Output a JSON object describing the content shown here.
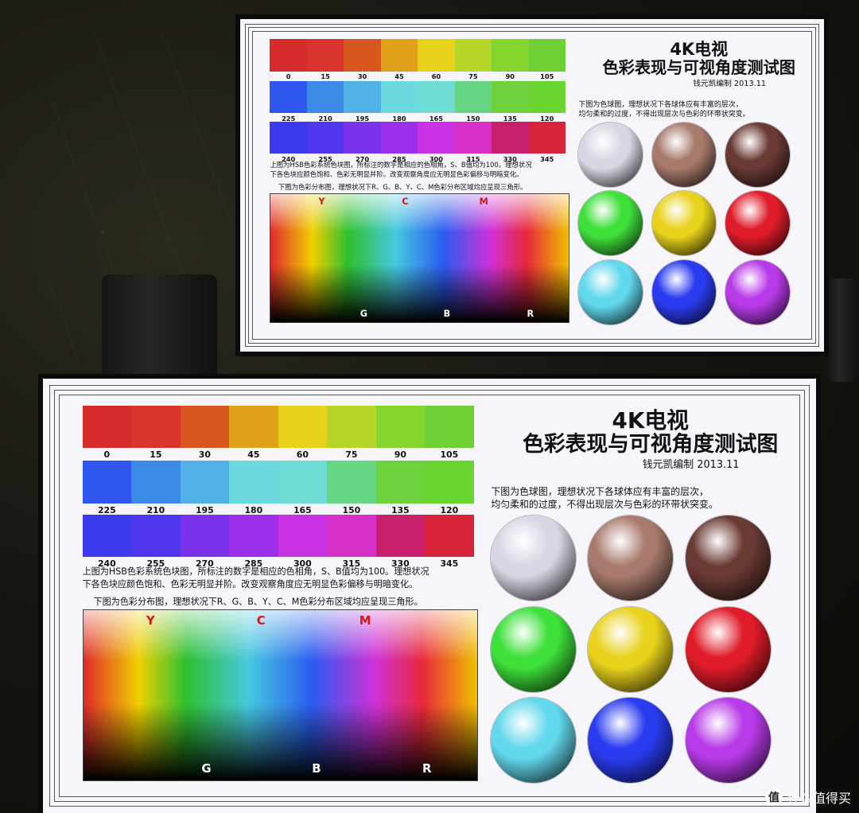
{
  "chart": {
    "title1": "4K电视",
    "title2": "色彩表现与可视角度测试图",
    "author": "钱元凯编制",
    "date": "2013.11",
    "row1": [
      {
        "label": "0",
        "color": "#d62b2b"
      },
      {
        "label": "15",
        "color": "#d8332c"
      },
      {
        "label": "30",
        "color": "#d8561f"
      },
      {
        "label": "45",
        "color": "#e0a21a"
      },
      {
        "label": "60",
        "color": "#e6d21a"
      },
      {
        "label": "75",
        "color": "#b6d62a"
      },
      {
        "label": "90",
        "color": "#86d52f"
      },
      {
        "label": "105",
        "color": "#6fd036"
      }
    ],
    "row2": [
      {
        "label": "225",
        "color": "#2f56ee"
      },
      {
        "label": "210",
        "color": "#3a8ae6"
      },
      {
        "label": "195",
        "color": "#52b2e6"
      },
      {
        "label": "180",
        "color": "#6cd8e0"
      },
      {
        "label": "165",
        "color": "#6edcd2"
      },
      {
        "label": "150",
        "color": "#66d684"
      },
      {
        "label": "135",
        "color": "#6ed23e"
      },
      {
        "label": "120",
        "color": "#6ad431"
      }
    ],
    "row3": [
      {
        "label": "240",
        "color": "#3c3aee"
      },
      {
        "label": "255",
        "color": "#4d36ee"
      },
      {
        "label": "270",
        "color": "#7a32ec"
      },
      {
        "label": "285",
        "color": "#9c30ea"
      },
      {
        "label": "300",
        "color": "#c832e4"
      },
      {
        "label": "315",
        "color": "#d630c8"
      },
      {
        "label": "330",
        "color": "#c8206c"
      },
      {
        "label": "345",
        "color": "#d8243a"
      }
    ],
    "caption1": "上图为HSB色彩系统色块图，所标注的数字是相应的色相角，S、B值均为100。理想状况",
    "caption2": "下各色块应颜色饱和、色彩无明显并阶。改变观察角度应无明显色彩偏移与明暗变化。",
    "dist_caption": "下图为色彩分布图，理想状况下R、G、B、Y、C、M色彩分布区域均应呈现三角形。",
    "dist_top": [
      "Y",
      "C",
      "M"
    ],
    "dist_bottom": [
      "G",
      "B",
      "R"
    ],
    "sphere_caption1": "下图为色球图，理想状况下各球体应有丰富的层次，",
    "sphere_caption2": "均匀柔和的过度，不得出现层次与色彩的环带状突变。",
    "spheres": [
      {
        "name": "gray",
        "color": "#d8d6e4"
      },
      {
        "name": "skin",
        "color": "#a87a6c"
      },
      {
        "name": "brown",
        "color": "#6a3a34"
      },
      {
        "name": "green",
        "color": "#3ee03a"
      },
      {
        "name": "yellow",
        "color": "#e8d21c"
      },
      {
        "name": "red",
        "color": "#e01c2a"
      },
      {
        "name": "cyan",
        "color": "#62d8ec"
      },
      {
        "name": "blue",
        "color": "#2a3cf0"
      },
      {
        "name": "purple",
        "color": "#b83ae8"
      }
    ]
  },
  "watermark": {
    "icon": "值",
    "text": "什么值得买"
  }
}
